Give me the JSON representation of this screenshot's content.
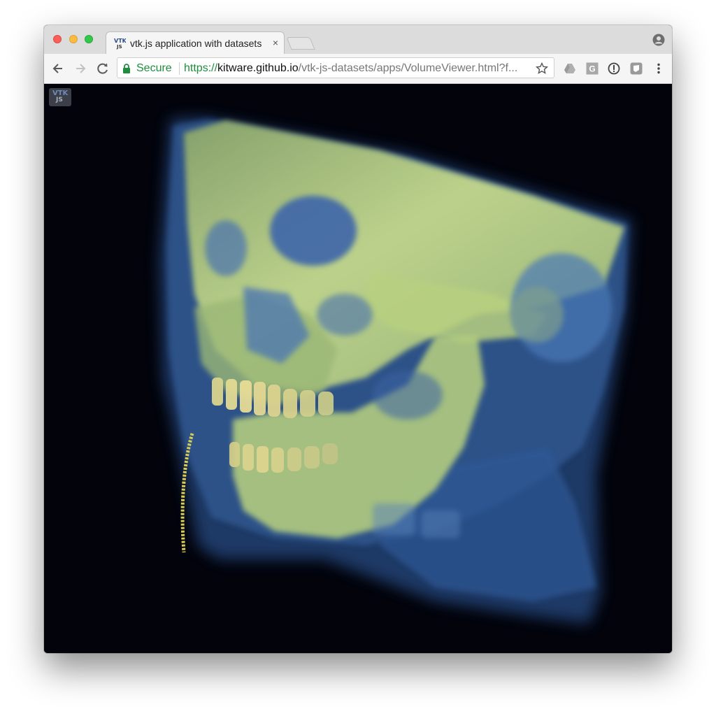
{
  "browser": {
    "tab": {
      "title": "vtk.js application with datasets",
      "close": "×",
      "favicon": {
        "line1": "VTK",
        "line2": "JS"
      }
    },
    "address_bar": {
      "security_label": "Secure",
      "url_scheme": "https://",
      "url_host": "kitware.github.io",
      "url_path": "/vtk-js-datasets/apps/VolumeViewer.html?f..."
    },
    "icons": {
      "back": "arrow-left-icon",
      "forward": "arrow-right-icon",
      "reload": "reload-icon",
      "lock": "lock-icon",
      "star": "star-icon",
      "profile": "profile-icon",
      "extensions": [
        "google-drive-icon",
        "g-extension-icon",
        "info-circle-icon",
        "shield-extension-icon",
        "kebab-menu-icon"
      ]
    }
  },
  "viewer": {
    "logo": {
      "line1": "VTK",
      "line2": "JS"
    },
    "render": {
      "subject": "volume-rendered CT skull",
      "colors": {
        "background": "#02030b",
        "bone": "#c8dc8a",
        "soft_tissue": "#3d6aa8",
        "teeth": "#e2d796"
      }
    }
  }
}
